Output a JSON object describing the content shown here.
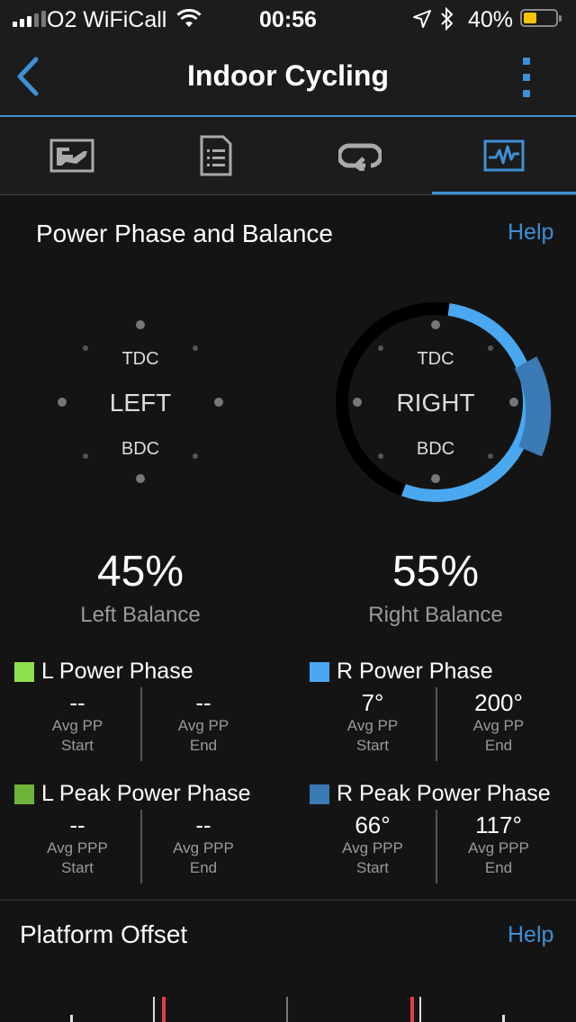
{
  "status_bar": {
    "carrier": "O2 WiFiCall",
    "time": "00:56",
    "battery": "40%",
    "battery_level": 0.4,
    "battery_color": "#f5c400"
  },
  "nav": {
    "title": "Indoor Cycling",
    "back_icon": "chevron-left-icon",
    "more_icon": "more-vertical-icon",
    "accent": "#3e8fd6"
  },
  "tabs": [
    {
      "icon": "map-icon",
      "active": false
    },
    {
      "icon": "document-list-icon",
      "active": false
    },
    {
      "icon": "laps-icon",
      "active": false
    },
    {
      "icon": "chart-icon",
      "active": true
    }
  ],
  "power_phase": {
    "title": "Power Phase and Balance",
    "help": "Help",
    "left_pedal": {
      "top": "TDC",
      "side": "LEFT",
      "bottom": "BDC"
    },
    "right_pedal": {
      "top": "TDC",
      "side": "RIGHT",
      "bottom": "BDC"
    },
    "left_balance": {
      "value": "45%",
      "label": "Left Balance"
    },
    "right_balance": {
      "value": "55%",
      "label": "Right Balance"
    },
    "l_power_phase": {
      "label": "L Power Phase",
      "color": "#8ee04a",
      "start": {
        "value": "--",
        "label1": "Avg PP",
        "label2": "Start"
      },
      "end": {
        "value": "--",
        "label1": "Avg PP",
        "label2": "End"
      }
    },
    "r_power_phase": {
      "label": "R Power Phase",
      "color": "#4aa8f0",
      "start": {
        "value": "7°",
        "label1": "Avg PP",
        "label2": "Start"
      },
      "end": {
        "value": "200°",
        "label1": "Avg PP",
        "label2": "End"
      }
    },
    "l_peak_power_phase": {
      "label": "L Peak Power Phase",
      "color": "#6fb33a",
      "start": {
        "value": "--",
        "label1": "Avg PPP",
        "label2": "Start"
      },
      "end": {
        "value": "--",
        "label1": "Avg PPP",
        "label2": "End"
      }
    },
    "r_peak_power_phase": {
      "label": "R Peak Power Phase",
      "color": "#3a7ab5",
      "start": {
        "value": "66°",
        "label1": "Avg PPP",
        "label2": "Start"
      },
      "end": {
        "value": "117°",
        "label1": "Avg PPP",
        "label2": "End"
      }
    }
  },
  "platform_offset": {
    "title": "Platform Offset",
    "help": "Help"
  }
}
